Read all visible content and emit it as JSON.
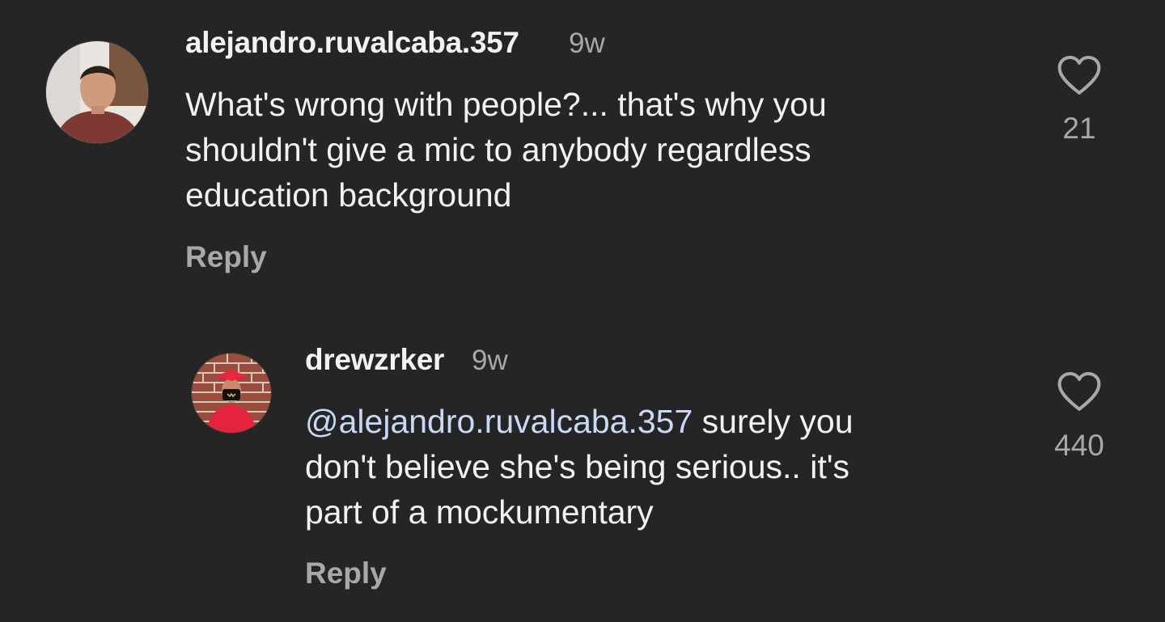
{
  "comments": [
    {
      "username": "alejandro.ruvalcaba.357",
      "time": "9w",
      "lines": [
        "What's wrong with people?... that's why you",
        "shouldn't give a mic to anybody regardless",
        "education background"
      ],
      "reply_label": "Reply",
      "like_count": "21"
    },
    {
      "username": "drewzrker",
      "time": "9w",
      "mention": "@alejandro.ruvalcaba.357",
      "line1_rest": " surely you",
      "lines_after": [
        "don't believe she's being serious.. it's",
        "part of a mockumentary"
      ],
      "reply_label": "Reply",
      "like_count": "440"
    }
  ],
  "colors": {
    "background": "#252525",
    "text": "#f2f2f2",
    "muted": "#a8a8a8",
    "mention": "#c9d8f5"
  },
  "icons": {
    "like": "heart-outline-icon"
  }
}
